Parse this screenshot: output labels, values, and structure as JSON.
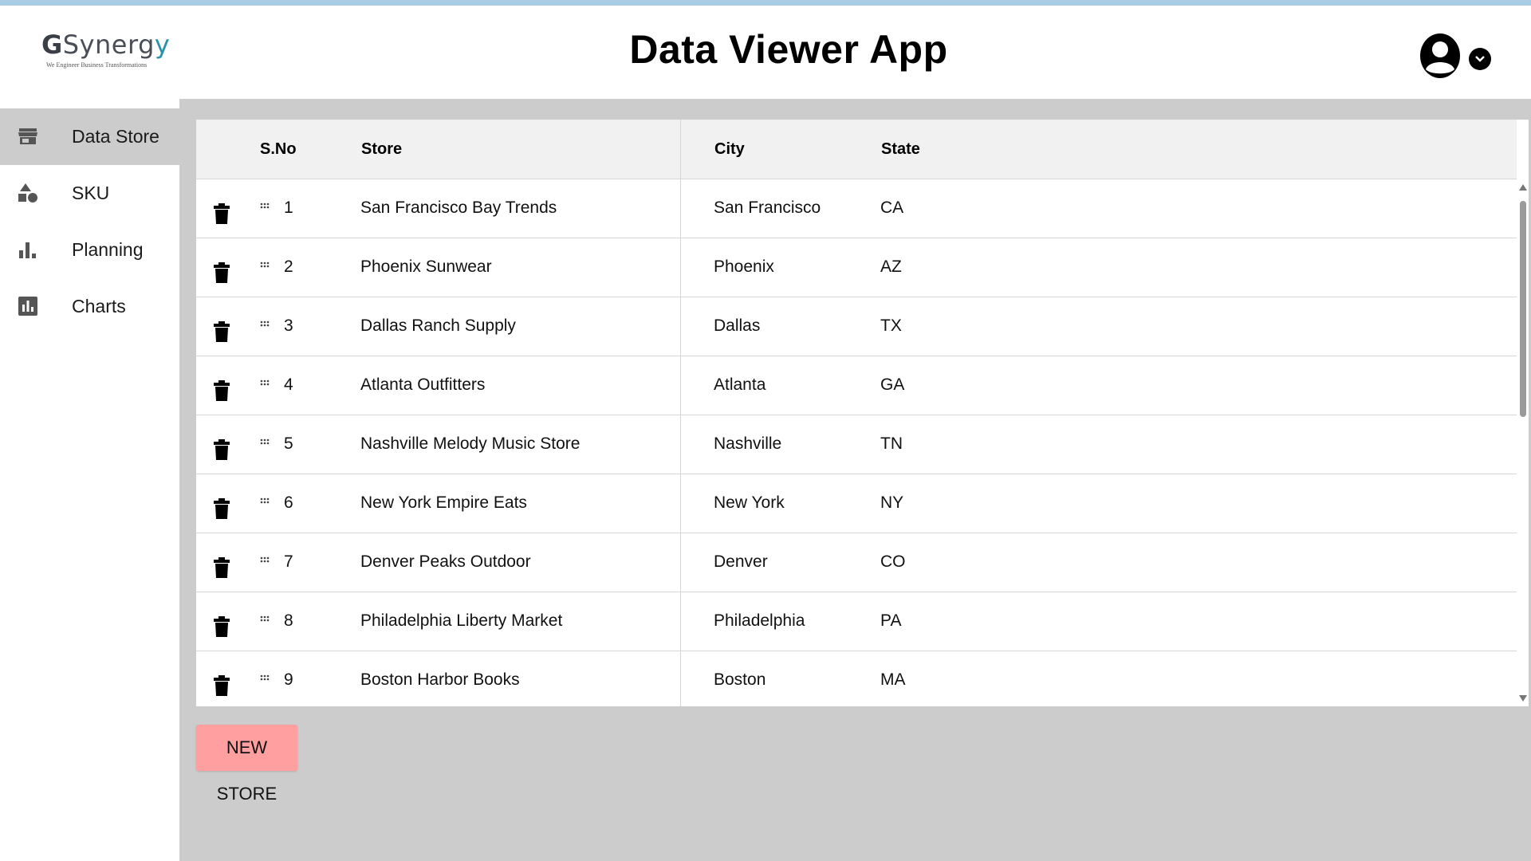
{
  "app": {
    "title": "Data Viewer App",
    "logo_text_prefix": "G",
    "logo_text_mid": "Synerg",
    "logo_text_o": "y",
    "logo_tagline": "We Engineer Business Transformations"
  },
  "sidebar": {
    "items": [
      {
        "label": "Data Store",
        "icon": "store-icon",
        "active": true
      },
      {
        "label": "SKU",
        "icon": "shapes-icon",
        "active": false
      },
      {
        "label": "Planning",
        "icon": "bar-chart-icon",
        "active": false
      },
      {
        "label": "Charts",
        "icon": "chart-box-icon",
        "active": false
      }
    ]
  },
  "table": {
    "headers": {
      "sno": "S.No",
      "store": "Store",
      "city": "City",
      "state": "State"
    },
    "rows": [
      {
        "sno": "1",
        "store": "San Francisco Bay Trends",
        "city": "San Francisco",
        "state": "CA"
      },
      {
        "sno": "2",
        "store": "Phoenix Sunwear",
        "city": "Phoenix",
        "state": "AZ"
      },
      {
        "sno": "3",
        "store": "Dallas Ranch Supply",
        "city": "Dallas",
        "state": "TX"
      },
      {
        "sno": "4",
        "store": "Atlanta Outfitters",
        "city": "Atlanta",
        "state": "GA"
      },
      {
        "sno": "5",
        "store": "Nashville Melody Music Store",
        "city": "Nashville",
        "state": "TN"
      },
      {
        "sno": "6",
        "store": "New York Empire Eats",
        "city": "New York",
        "state": "NY"
      },
      {
        "sno": "7",
        "store": "Denver Peaks Outdoor",
        "city": "Denver",
        "state": "CO"
      },
      {
        "sno": "8",
        "store": "Philadelphia Liberty Market",
        "city": "Philadelphia",
        "state": "PA"
      },
      {
        "sno": "9",
        "store": "Boston Harbor Books",
        "city": "Boston",
        "state": "MA"
      }
    ]
  },
  "actions": {
    "new_store_label": "NEW STORE"
  },
  "colors": {
    "accent_button": "#ff9f9f",
    "main_bg": "#cccccc",
    "header_bg": "#f1f1f1",
    "top_stripe": "#a9cde6"
  }
}
